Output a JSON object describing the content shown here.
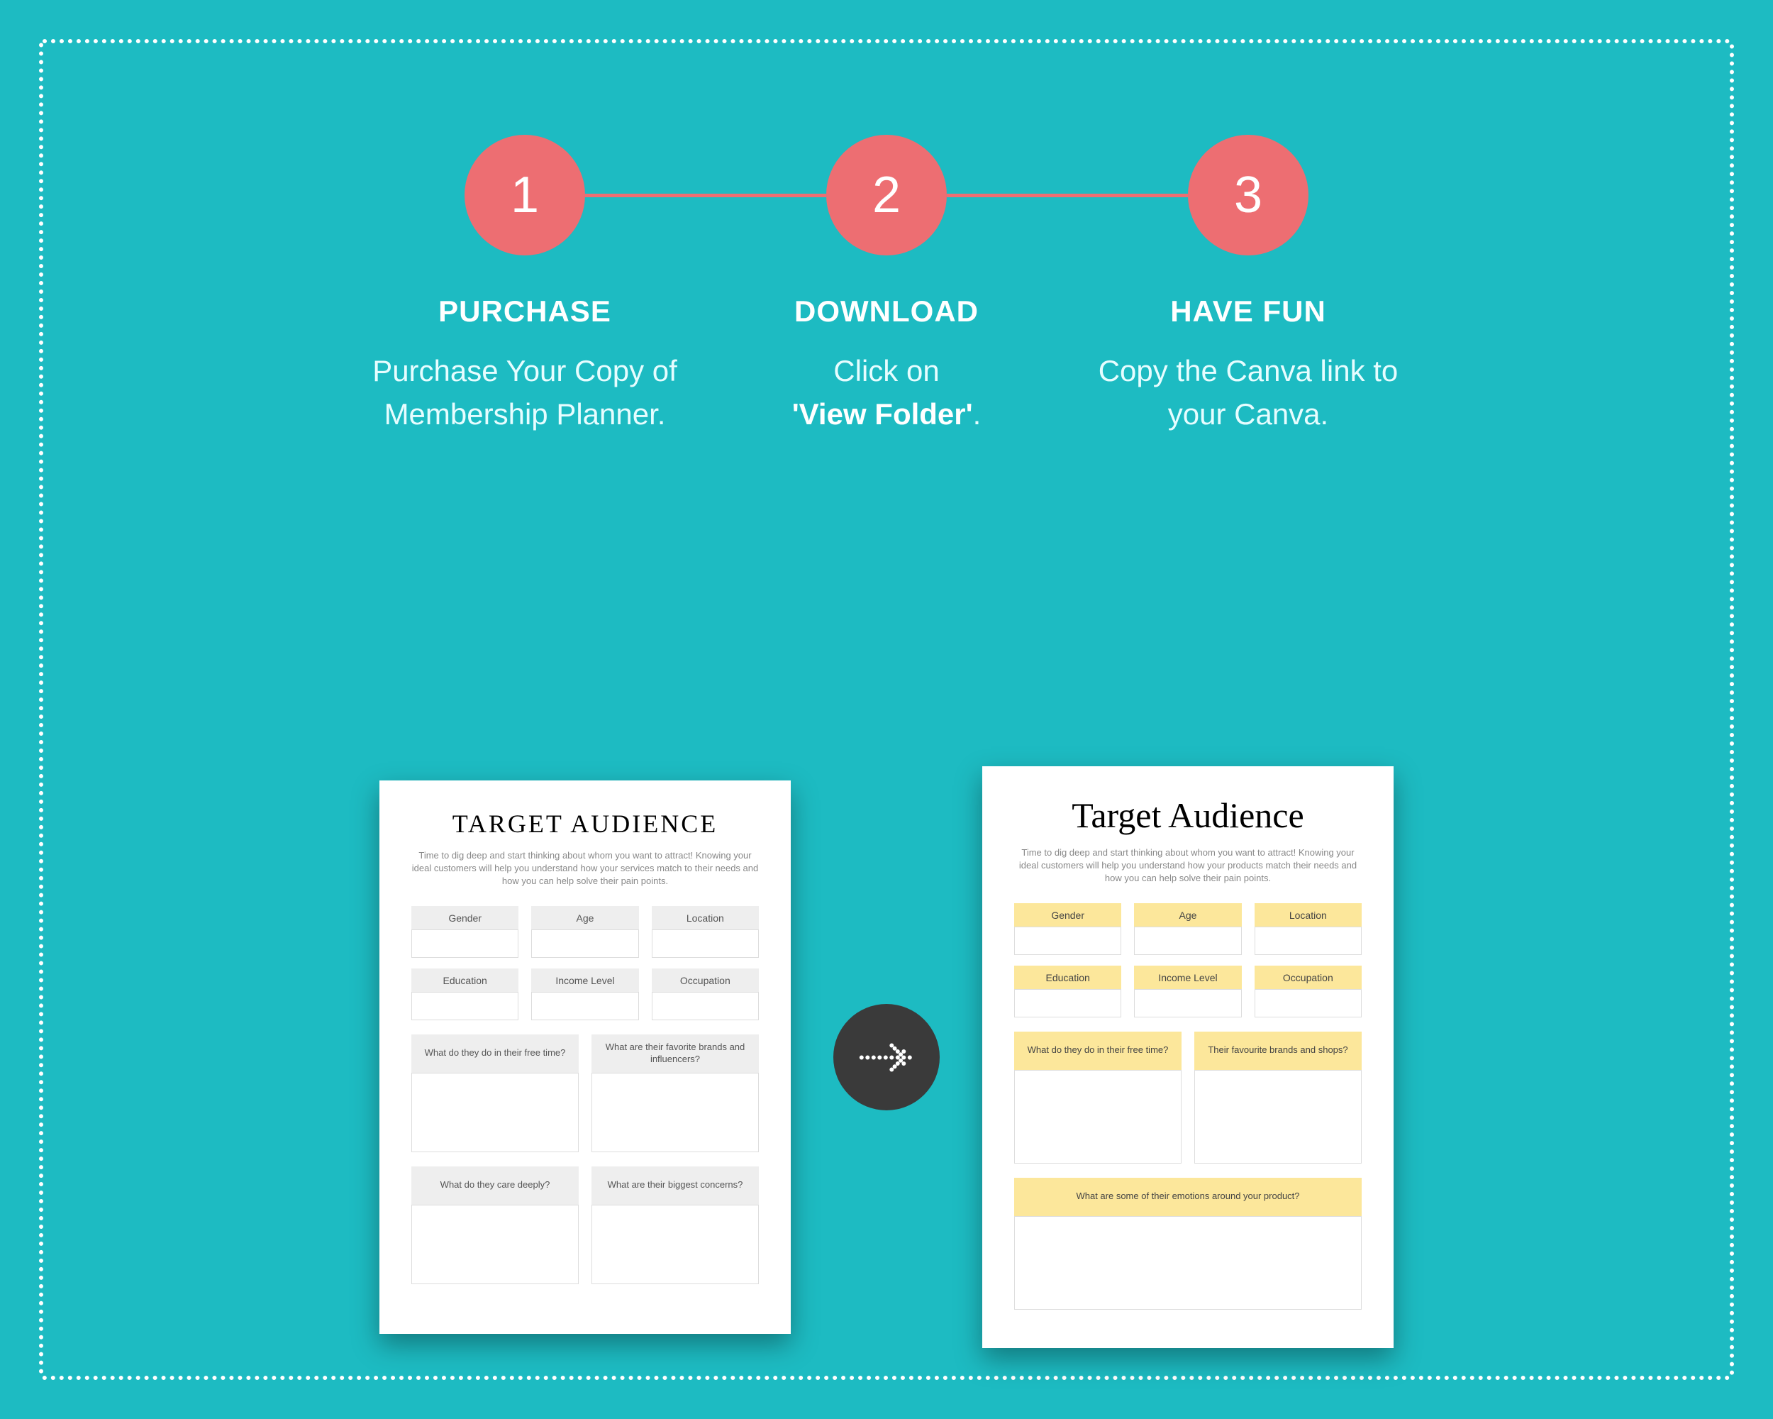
{
  "steps": [
    {
      "num": "1",
      "title": "PURCHASE",
      "desc": "Purchase Your Copy of Membership Planner."
    },
    {
      "num": "2",
      "title": "DOWNLOAD",
      "desc_pre": "Click  on ",
      "desc_bold": "'View Folder'",
      "desc_post": "."
    },
    {
      "num": "3",
      "title": "HAVE FUN",
      "desc": "Copy the Canva link to your Canva."
    }
  ],
  "sheet_left": {
    "heading": "TARGET AUDIENCE",
    "intro": "Time to dig deep and start thinking about whom you want to attract! Knowing your ideal customers will help you understand how your services match to their needs and how you can help solve their pain points.",
    "fields_row1": [
      "Gender",
      "Age",
      "Location"
    ],
    "fields_row2": [
      "Education",
      "Income Level",
      "Occupation"
    ],
    "boxes_row1": [
      "What do they do in their free time?",
      "What are their favorite brands and influencers?"
    ],
    "boxes_row2": [
      "What do they care deeply?",
      "What are their biggest concerns?"
    ]
  },
  "sheet_right": {
    "heading": "Target Audience",
    "intro": "Time to dig deep and start thinking about whom you want to attract! Knowing your ideal customers will help you understand how your products match their needs and how you can help solve their pain points.",
    "fields_row1": [
      "Gender",
      "Age",
      "Location"
    ],
    "fields_row2": [
      "Education",
      "Income Level",
      "Occupation"
    ],
    "boxes_row1": [
      "What do they do in their free time?",
      "Their favourite brands and shops?"
    ],
    "full_box": "What are some of their emotions around your product?"
  }
}
